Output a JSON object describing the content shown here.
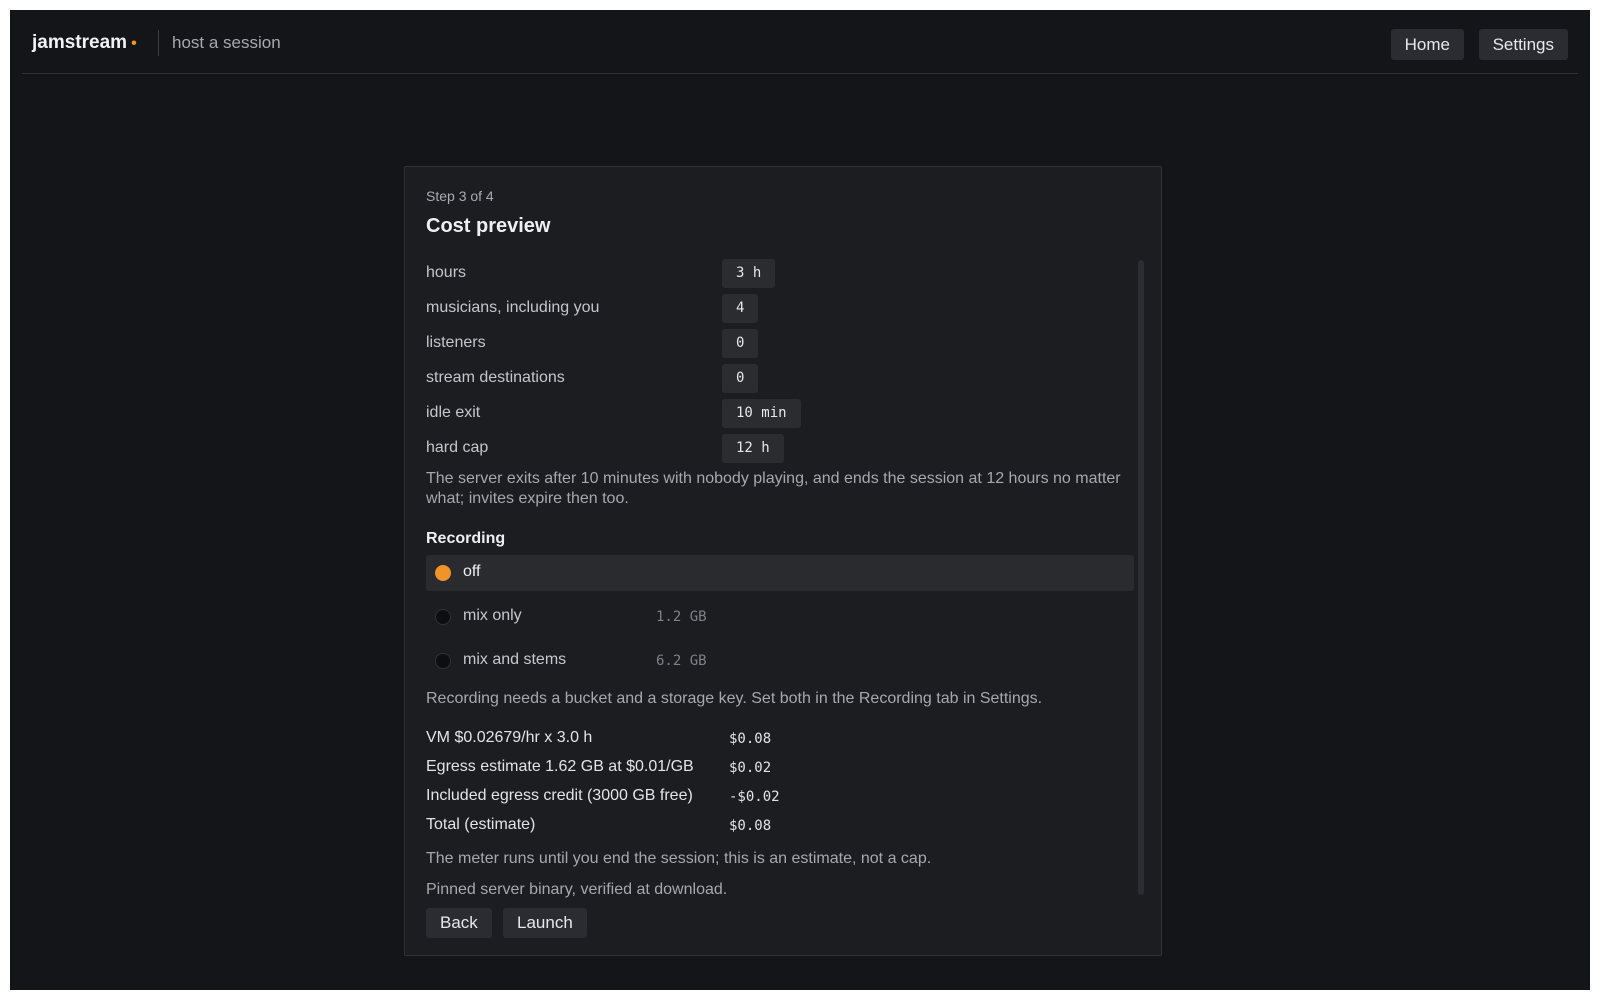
{
  "header": {
    "brand": "jamstream",
    "brand_dot": "•",
    "subtitle": "host a session",
    "nav": {
      "home": "Home",
      "settings": "Settings"
    }
  },
  "card": {
    "step": "Step 3 of 4",
    "title": "Cost preview",
    "fields": [
      {
        "label": "hours",
        "value": "3 h"
      },
      {
        "label": "musicians, including you",
        "value": "4"
      },
      {
        "label": "listeners",
        "value": "0"
      },
      {
        "label": "stream destinations",
        "value": "0"
      },
      {
        "label": "idle exit",
        "value": "10 min"
      },
      {
        "label": "hard cap",
        "value": "12 h"
      }
    ],
    "exit_note": "The server exits after 10 minutes with nobody playing, and ends the session at 12 hours no matter what; invites expire then too.",
    "recording": {
      "heading": "Recording",
      "options": [
        {
          "label": "off",
          "size": "",
          "selected": true
        },
        {
          "label": "mix only",
          "size": "1.2 GB",
          "selected": false
        },
        {
          "label": "mix and stems",
          "size": "6.2 GB",
          "selected": false
        }
      ],
      "note": "Recording needs a bucket and a storage key. Set both in the Recording tab in Settings."
    },
    "costs": [
      {
        "label": "VM $0.02679/hr x 3.0 h",
        "value": "$0.08"
      },
      {
        "label": "Egress estimate 1.62 GB at $0.01/GB",
        "value": "$0.02"
      },
      {
        "label": "Included egress credit (3000 GB free)",
        "value": "-$0.02"
      },
      {
        "label": "Total (estimate)",
        "value": "$0.08"
      }
    ],
    "meter_note": "The meter runs until you end the session; this is an estimate, not a cap.",
    "binary_note": "Pinned server binary, verified at download.",
    "actions": {
      "back": "Back",
      "launch": "Launch"
    }
  },
  "colors": {
    "accent": "#f0932b",
    "background": "#141518",
    "card": "#1c1d21"
  }
}
